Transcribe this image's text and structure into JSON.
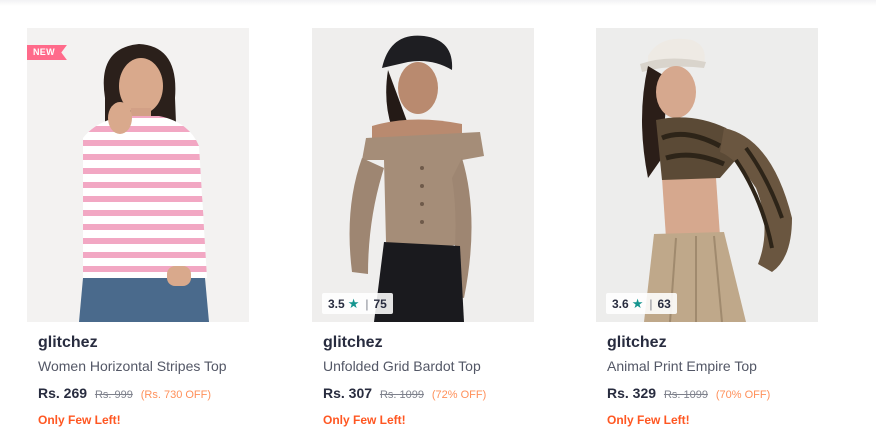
{
  "products": [
    {
      "badge": "NEW",
      "brand": "glitchez",
      "name": "Women Horizontal Stripes Top",
      "price": "Rs. 269",
      "mrp": "Rs. 999",
      "discount": "(Rs. 730 OFF)",
      "stock_note": "Only Few Left!"
    },
    {
      "rating": "3.5",
      "rating_count": "75",
      "brand": "glitchez",
      "name": "Unfolded Grid Bardot Top",
      "price": "Rs. 307",
      "mrp": "Rs. 1099",
      "discount": "(72% OFF)",
      "stock_note": "Only Few Left!"
    },
    {
      "rating": "3.6",
      "rating_count": "63",
      "brand": "glitchez",
      "name": "Animal Print Empire Top",
      "price": "Rs. 329",
      "mrp": "Rs. 1099",
      "discount": "(70% OFF)",
      "stock_note": "Only Few Left!"
    }
  ],
  "icons": {
    "rating": "star-icon"
  },
  "colors": {
    "badge_new": "#ff6b8b",
    "rating_star": "#14958f",
    "discount": "#ff905a",
    "stock_note": "#ff5722"
  }
}
